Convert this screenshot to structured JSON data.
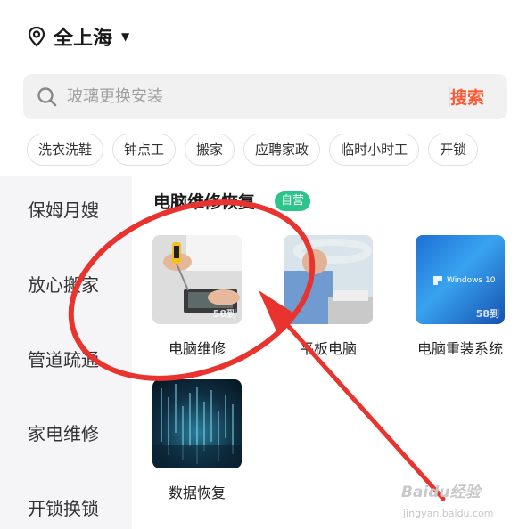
{
  "header": {
    "location": "全上海"
  },
  "search": {
    "placeholder": "玻璃更换安装",
    "button": "搜索"
  },
  "chips": [
    "洗衣洗鞋",
    "钟点工",
    "搬家",
    "应聘家政",
    "临时小时工",
    "开锁"
  ],
  "sidebar": {
    "items": [
      "保姆月嫂",
      "放心搬家",
      "管道疏通",
      "家电维修",
      "开锁换锁"
    ]
  },
  "section": {
    "title": "电脑维修恢复",
    "badge": "自营",
    "tiles": [
      {
        "label": "电脑维修"
      },
      {
        "label": "平板电脑"
      },
      {
        "label": "电脑重装系统",
        "image_text": "Windows 10"
      },
      {
        "label": "数据恢复"
      }
    ],
    "watermark": "58到"
  },
  "watermark": {
    "brand": "Baidu经验",
    "url": "jingyan.baidu.com"
  },
  "colors": {
    "accent": "#ff552e",
    "badge": "#2bc48a",
    "annotation": "#e8332f"
  }
}
